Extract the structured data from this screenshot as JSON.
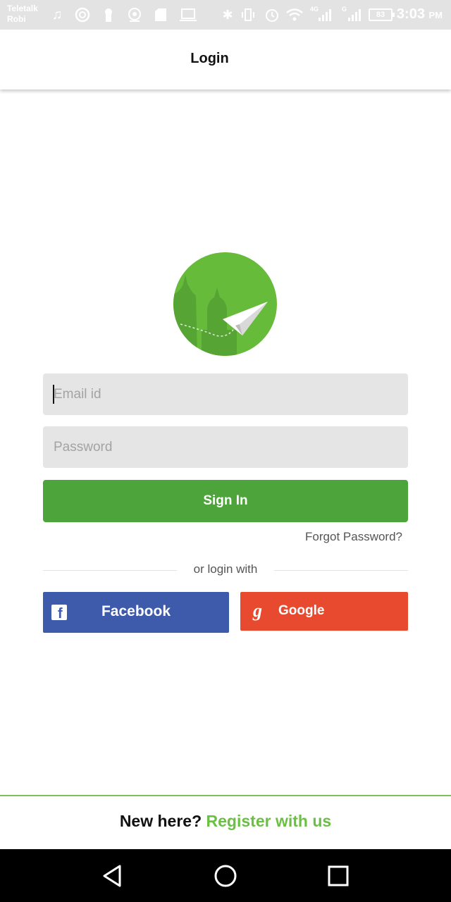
{
  "status_bar": {
    "carrier_1": "Teletalk",
    "carrier_2": "Robi",
    "network_1": "4G",
    "network_2": "G",
    "battery": "83",
    "time": "3:03",
    "ampm": "PM",
    "icons": [
      "music-icon",
      "app-icon",
      "lock-icon",
      "target-icon",
      "message-icon",
      "laptop-icon",
      "bluetooth-icon",
      "vibrate-icon",
      "alarm-icon",
      "wifi-icon",
      "signal-icon",
      "signal-icon"
    ]
  },
  "app_bar": {
    "title": "Login"
  },
  "logo": {
    "icon": "paper-plane-mosque-logo",
    "colors": {
      "background": "#66bb3a",
      "dark": "#4f9e32",
      "plane": "#ffffff"
    }
  },
  "form": {
    "email_placeholder": "Email id",
    "email_value": "",
    "password_placeholder": "Password",
    "password_value": "",
    "signin_label": "Sign In",
    "forgot_label": "Forgot Password?"
  },
  "divider": {
    "text": "or login with"
  },
  "social": {
    "facebook_label": "Facebook",
    "facebook_icon": "facebook-icon",
    "google_label": "Google",
    "google_icon": "google-icon"
  },
  "footer": {
    "prompt": "New here?",
    "register_label": "Register with us"
  },
  "nav_bar": {
    "icons": [
      "back-icon",
      "home-icon",
      "recents-icon"
    ]
  },
  "colors": {
    "accent_green": "#4ca43a",
    "facebook_blue": "#3e5bab",
    "google_red": "#e84a30",
    "link_green": "#6cbf45"
  }
}
